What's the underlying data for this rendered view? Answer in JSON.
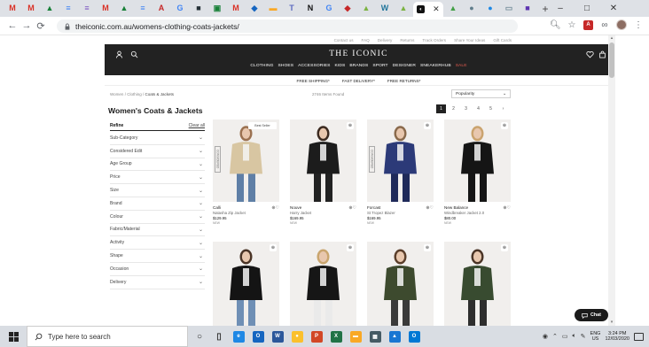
{
  "browser": {
    "tabs": [
      {
        "icon": "gmail-icon",
        "glyph": "M",
        "color": "#d93025"
      },
      {
        "icon": "gmail-icon",
        "glyph": "M",
        "color": "#d93025"
      },
      {
        "icon": "drive-icon",
        "glyph": "▲",
        "color": "#188038"
      },
      {
        "icon": "docs-icon",
        "glyph": "≡",
        "color": "#4285f4"
      },
      {
        "icon": "forms-icon",
        "glyph": "≡",
        "color": "#7e57c2"
      },
      {
        "icon": "gmail-icon",
        "glyph": "M",
        "color": "#d93025"
      },
      {
        "icon": "drive-icon",
        "glyph": "▲",
        "color": "#188038"
      },
      {
        "icon": "docs-icon",
        "glyph": "≡",
        "color": "#4285f4"
      },
      {
        "icon": "letter-a-icon",
        "glyph": "A",
        "color": "#c62828"
      },
      {
        "icon": "google-icon",
        "glyph": "G",
        "color": "#4285f4"
      },
      {
        "icon": "page-icon",
        "glyph": "■",
        "color": "#263238"
      },
      {
        "icon": "classroom-icon",
        "glyph": "▣",
        "color": "#188038"
      },
      {
        "icon": "gmail-icon",
        "glyph": "M",
        "color": "#d93025"
      },
      {
        "icon": "sites-icon",
        "glyph": "◆",
        "color": "#1565c0"
      },
      {
        "icon": "slides-icon",
        "glyph": "▬",
        "color": "#f9a825"
      },
      {
        "icon": "teams-icon",
        "glyph": "T",
        "color": "#5c6bc0"
      },
      {
        "icon": "notion-icon",
        "glyph": "N",
        "color": "#111111"
      },
      {
        "icon": "google-icon",
        "glyph": "G",
        "color": "#4285f4"
      },
      {
        "icon": "bookmark-icon",
        "glyph": "◆",
        "color": "#c62828"
      },
      {
        "icon": "sheets-icon",
        "glyph": "▲",
        "color": "#7cb342"
      },
      {
        "icon": "wordpress-icon",
        "glyph": "W",
        "color": "#21759b"
      },
      {
        "icon": "sheets-icon",
        "glyph": "▲",
        "color": "#7cb342"
      },
      {
        "icon": "sheets-icon",
        "glyph": "▲",
        "color": "#43a047"
      },
      {
        "icon": "extension-icon",
        "glyph": "●",
        "color": "#607d8b"
      },
      {
        "icon": "meet-icon",
        "glyph": "●",
        "color": "#1e88e5"
      },
      {
        "icon": "doc-icon",
        "glyph": "▭",
        "color": "#78909c"
      },
      {
        "icon": "app-icon",
        "glyph": "■",
        "color": "#5e35b1"
      }
    ],
    "active_tab_icon": "the-iconic-icon",
    "new_tab": "+",
    "address": "theiconic.com.au/womens-clothing-coats-jackets/",
    "window_controls": [
      "–",
      "□",
      "✕"
    ],
    "nav": [
      "←",
      "→",
      "⟳"
    ]
  },
  "site": {
    "utility_links": [
      "Contact us",
      "FAQ",
      "Delivery",
      "Returns",
      "Track Orders",
      "Share Your Ideas",
      "Gift Cards"
    ],
    "brand": "THE ICONIC",
    "categories": [
      "CLOTHING",
      "SHOES",
      "ACCESSORIES",
      "KIDS",
      "BRANDS",
      "SPORT",
      "DESIGNER",
      "SNEAKERHUB",
      "SALE"
    ],
    "sale_color": "#e05a4e",
    "promos": [
      "FREE SHIPPING*",
      "FAST DELIVERY*",
      "FREE RETURNS*"
    ],
    "breadcrumb": {
      "parts": [
        "Women",
        "Clothing"
      ],
      "current": "Coats & Jackets",
      "sep": " / "
    },
    "item_count": "2746 Items Found",
    "sort": {
      "selected": "Popularity"
    },
    "page_title": "Women's Coats & Jackets",
    "pagination": {
      "current": "1",
      "pages": [
        "1",
        "2",
        "3",
        "4",
        "5"
      ],
      "next": "›"
    },
    "refine": {
      "title": "Refine",
      "clear": "Clear all"
    },
    "filters": [
      "Sub-Category",
      "Considered Edit",
      "Age Group",
      "Price",
      "Size",
      "Brand",
      "Colour",
      "Fabric/Material",
      "Activity",
      "Shape",
      "Occasion",
      "Delivery"
    ],
    "products": [
      {
        "brand": "Calli",
        "name": "Natasha Zip Jacket",
        "price": "$129.95",
        "tag": "NEW",
        "badge": "Best Seller",
        "considered": "CONSIDERED",
        "garment": "#d8c6a2",
        "under": "#5f7fa6",
        "hair": "#9b7150"
      },
      {
        "brand": "Nouve",
        "name": "Harry Jacket",
        "price": "$169.95",
        "tag": "NEW",
        "badge": "",
        "considered": "",
        "garment": "#1c1c1c",
        "under": "#222222",
        "hair": "#3b2a20"
      },
      {
        "brand": "Forcast",
        "name": "St Tropez Blazer",
        "price": "$169.95",
        "tag": "NEW",
        "badge": "",
        "considered": "CONSIDERED",
        "garment": "#2c3a78",
        "under": "#1f2a5a",
        "hair": "#8a6a4c"
      },
      {
        "brand": "New Balance",
        "name": "Windbreaker Jacket 2.0",
        "price": "$80.00",
        "tag": "NEW",
        "badge": "",
        "considered": "",
        "garment": "#151515",
        "under": "#151515",
        "hair": "#caa36e"
      },
      {
        "brand": "",
        "name": "",
        "price": "",
        "tag": "",
        "badge": "",
        "considered": "",
        "garment": "#141414",
        "under": "#6f8fb5",
        "hair": "#4a3426"
      },
      {
        "brand": "",
        "name": "",
        "price": "",
        "tag": "",
        "badge": "",
        "considered": "",
        "garment": "#161616",
        "under": "#eaeaea",
        "hair": "#c9a56e"
      },
      {
        "brand": "",
        "name": "",
        "price": "",
        "tag": "",
        "badge": "",
        "considered": "",
        "garment": "#3d4a2e",
        "under": "#3a3a3a",
        "hair": "#5a3e2a"
      },
      {
        "brand": "",
        "name": "",
        "price": "",
        "tag": "",
        "badge": "",
        "considered": "",
        "garment": "#384b30",
        "under": "#2e2e2e",
        "hair": "#4a3426"
      }
    ],
    "chat_label": "Chat"
  },
  "taskbar": {
    "search_placeholder": "Type here to search",
    "apps": [
      {
        "icon": "cortana-icon",
        "glyph": "○",
        "color": "#222222"
      },
      {
        "icon": "task-view-icon",
        "glyph": "▯",
        "color": "#333333"
      },
      {
        "icon": "edge-icon",
        "glyph": "e",
        "color": "#1e88e5"
      },
      {
        "icon": "outlook-icon",
        "glyph": "O",
        "color": "#1565c0"
      },
      {
        "icon": "word-icon",
        "glyph": "W",
        "color": "#2b579a"
      },
      {
        "icon": "chrome-icon",
        "glyph": "●",
        "color": "#fbc02d"
      },
      {
        "icon": "powerpoint-icon",
        "glyph": "P",
        "color": "#d24726"
      },
      {
        "icon": "excel-icon",
        "glyph": "X",
        "color": "#217346"
      },
      {
        "icon": "file-explorer-icon",
        "glyph": "▬",
        "color": "#f9a825"
      },
      {
        "icon": "calculator-icon",
        "glyph": "▦",
        "color": "#455a64"
      },
      {
        "icon": "photos-icon",
        "glyph": "▲",
        "color": "#1976d2"
      },
      {
        "icon": "outlook-icon",
        "glyph": "O",
        "color": "#0078d4"
      }
    ],
    "tray": {
      "language": "ENG",
      "region": "US",
      "time": "3:24 PM",
      "date": "12/03/2020"
    }
  }
}
